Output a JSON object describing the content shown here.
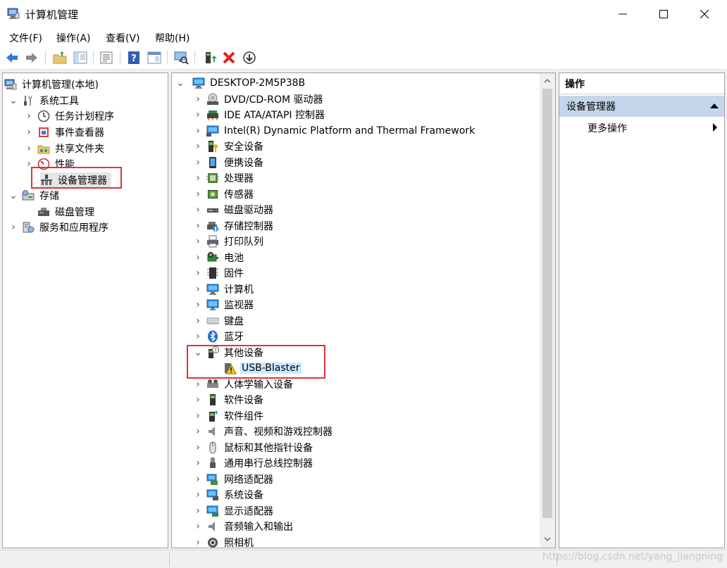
{
  "window": {
    "title": "计算机管理",
    "controls": [
      "minimize-icon",
      "maximize-icon",
      "close-icon"
    ]
  },
  "menubar": {
    "items": [
      "文件(F)",
      "操作(A)",
      "查看(V)",
      "帮助(H)"
    ]
  },
  "toolbar": {
    "icons": [
      "back-arrow-icon",
      "forward-arrow-icon",
      "up-folder-icon",
      "show-hide-tree-icon",
      "export-list-icon",
      "help-icon",
      "properties-icon",
      "scan-hardware-icon",
      "update-driver-icon",
      "uninstall-icon",
      "disable-device-icon"
    ]
  },
  "left_tree": {
    "root": "计算机管理(本地)",
    "system_tools": "系统工具",
    "system_tools_items": [
      "任务计划程序",
      "事件查看器",
      "共享文件夹",
      "性能",
      "设备管理器"
    ],
    "storage": "存储",
    "storage_items": [
      "磁盘管理"
    ],
    "services": "服务和应用程序"
  },
  "device_tree": {
    "computer": "DESKTOP-2M5P38B",
    "categories_before": [
      {
        "label": "DVD/CD-ROM 驱动器",
        "icon": "dvd-drive-icon"
      },
      {
        "label": "IDE ATA/ATAPI 控制器",
        "icon": "ide-controller-icon"
      },
      {
        "label": "Intel(R) Dynamic Platform and Thermal Framework",
        "icon": "intel-dptf-icon"
      },
      {
        "label": "安全设备",
        "icon": "security-device-icon"
      },
      {
        "label": "便携设备",
        "icon": "portable-device-icon"
      },
      {
        "label": "处理器",
        "icon": "processor-icon"
      },
      {
        "label": "传感器",
        "icon": "sensor-icon"
      },
      {
        "label": "磁盘驱动器",
        "icon": "disk-drive-icon"
      },
      {
        "label": "存储控制器",
        "icon": "storage-controller-icon"
      },
      {
        "label": "打印队列",
        "icon": "printer-icon"
      },
      {
        "label": "电池",
        "icon": "battery-icon"
      },
      {
        "label": "固件",
        "icon": "firmware-icon"
      },
      {
        "label": "计算机",
        "icon": "computer-icon"
      },
      {
        "label": "监视器",
        "icon": "monitor-icon"
      },
      {
        "label": "键盘",
        "icon": "keyboard-icon"
      },
      {
        "label": "蓝牙",
        "icon": "bluetooth-icon"
      }
    ],
    "other_devices": {
      "label": "其他设备",
      "child": "USB-Blaster"
    },
    "categories_after": [
      {
        "label": "人体学输入设备",
        "icon": "hid-icon"
      },
      {
        "label": "软件设备",
        "icon": "software-device-icon"
      },
      {
        "label": "软件组件",
        "icon": "software-component-icon"
      },
      {
        "label": "声音、视频和游戏控制器",
        "icon": "sound-icon"
      },
      {
        "label": "鼠标和其他指针设备",
        "icon": "mouse-icon"
      },
      {
        "label": "通用串行总线控制器",
        "icon": "usb-controller-icon"
      },
      {
        "label": "网络适配器",
        "icon": "network-adapter-icon"
      },
      {
        "label": "系统设备",
        "icon": "system-device-icon"
      },
      {
        "label": "显示适配器",
        "icon": "display-adapter-icon"
      },
      {
        "label": "音频输入和输出",
        "icon": "audio-io-icon"
      },
      {
        "label": "照相机",
        "icon": "camera-icon"
      }
    ]
  },
  "actions": {
    "header": "操作",
    "group": "设备管理器",
    "more": "更多操作"
  },
  "watermark": "https://blog.csdn.net/yang_jiangning"
}
